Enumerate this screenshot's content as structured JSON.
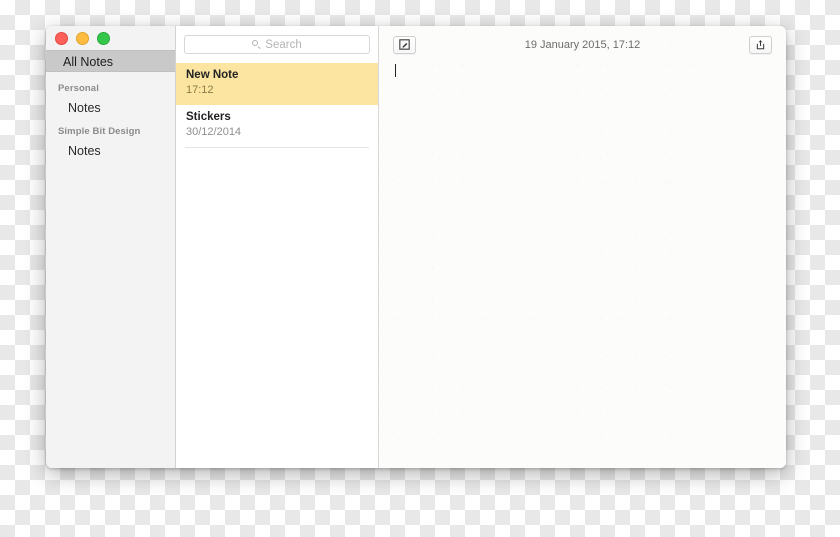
{
  "window": {
    "traffic_lights": [
      {
        "name": "close",
        "color": "#fc6058"
      },
      {
        "name": "minimize",
        "color": "#fdbc40"
      },
      {
        "name": "zoom",
        "color": "#34c749"
      }
    ]
  },
  "sidebar": {
    "selected_item": "All Notes",
    "groups": [
      {
        "label": "Personal",
        "items": [
          "Notes"
        ]
      },
      {
        "label": "Simple Bit Design",
        "items": [
          "Notes"
        ]
      }
    ]
  },
  "search": {
    "icon": "search-icon",
    "placeholder": "Search",
    "value": ""
  },
  "notes_list": [
    {
      "title": "New Note",
      "date": "17:12",
      "selected": true
    },
    {
      "title": "Stickers",
      "date": "30/12/2014",
      "selected": false
    }
  ],
  "toolbar": {
    "compose_icon": "compose-icon",
    "compose_label": "New Note",
    "date": "19 January 2015, 17:12",
    "share_icon": "share-icon",
    "share_label": "Share"
  },
  "editor": {
    "body": ""
  }
}
